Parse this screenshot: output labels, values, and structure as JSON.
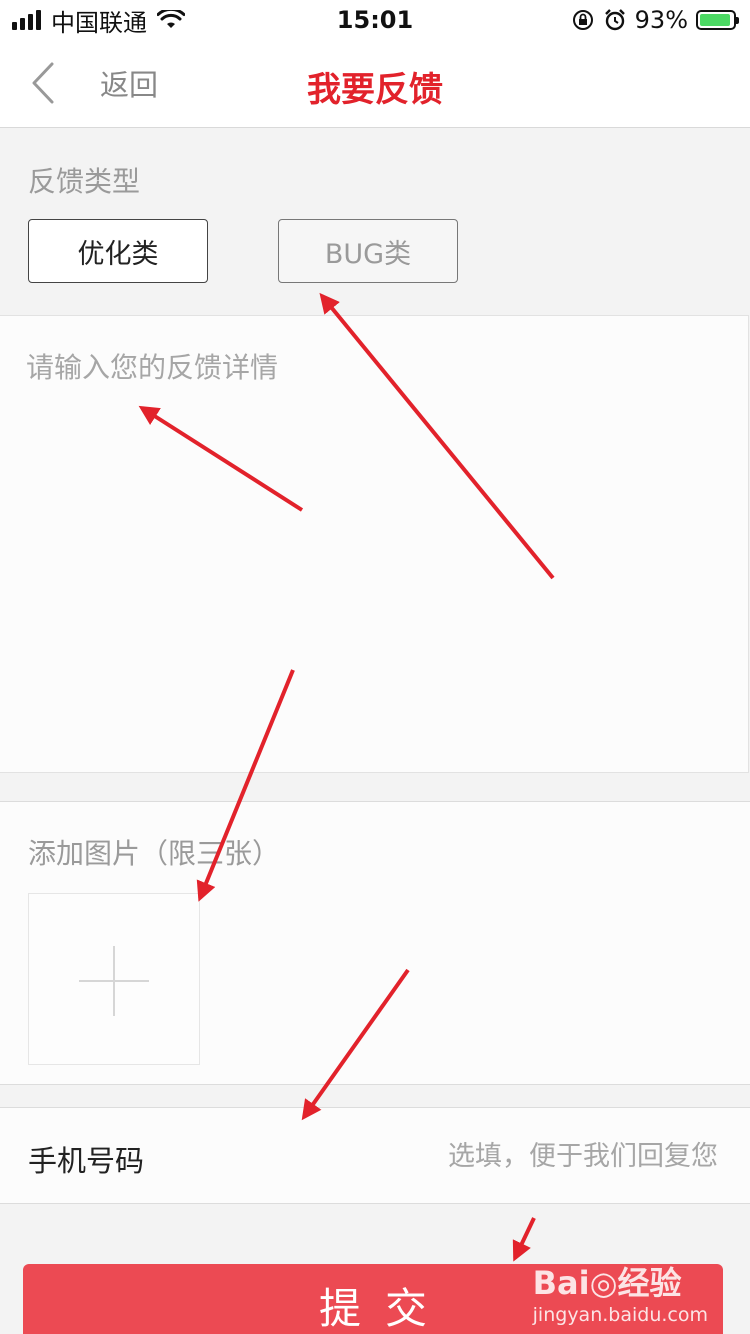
{
  "status_bar": {
    "carrier": "中国联通",
    "time": "15:01",
    "battery_percent": "93%",
    "battery_level": 0.93,
    "battery_color": "#4cd964"
  },
  "nav": {
    "back_label": "返回",
    "title": "我要反馈",
    "title_color": "#e2222b"
  },
  "feedback_type": {
    "label": "反馈类型",
    "options": [
      "优化类",
      "BUG类"
    ],
    "selected": "优化类"
  },
  "feedback_detail": {
    "placeholder": "请输入您的反馈详情",
    "value": ""
  },
  "photos": {
    "label": "添加图片（限三张）",
    "add_icon": "plus-icon"
  },
  "phone": {
    "label": "手机号码",
    "placeholder": "选填，便于我们回复您",
    "value": ""
  },
  "submit": {
    "label": "提交",
    "color": "#ec4a53"
  },
  "watermark": {
    "logo": "Bai◎经验",
    "url": "jingyan.baidu.com"
  },
  "annotation_color": "#e2222b"
}
